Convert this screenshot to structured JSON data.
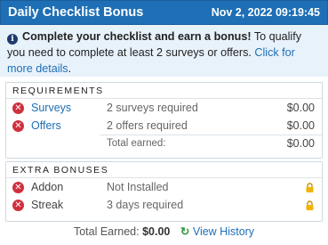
{
  "header": {
    "title": "Daily Checklist Bonus",
    "datetime": "Nov 2, 2022 09:19:45"
  },
  "info": {
    "icon": "info-icon",
    "strong": "Complete your checklist and earn a bonus!",
    "text": " To qualify you need to complete at least 2 surveys or offers. ",
    "link": "Click for more details",
    "end": "."
  },
  "requirements": {
    "heading": "REQUIREMENTS",
    "rows": [
      {
        "name": "Surveys",
        "desc": "2 surveys required",
        "amount": "$0.00"
      },
      {
        "name": "Offers",
        "desc": "2 offers required",
        "amount": "$0.00"
      }
    ],
    "total_label": "Total earned:",
    "total_amount": "$0.00"
  },
  "extra_bonuses": {
    "heading": "EXTRA BONUSES",
    "rows": [
      {
        "name": "Addon",
        "desc": "Not Installed"
      },
      {
        "name": "Streak",
        "desc": "3 days required"
      }
    ]
  },
  "footer": {
    "label": "Total Earned:",
    "value": "$0.00",
    "history_icon": "↻",
    "history_label": "View History"
  },
  "colors": {
    "header_bg": "#1e6fb5",
    "info_bg": "#e8f2fb",
    "x_icon": "#cf2f3d",
    "lock": "#f0b400",
    "history_icon": "#2e9a3c"
  }
}
